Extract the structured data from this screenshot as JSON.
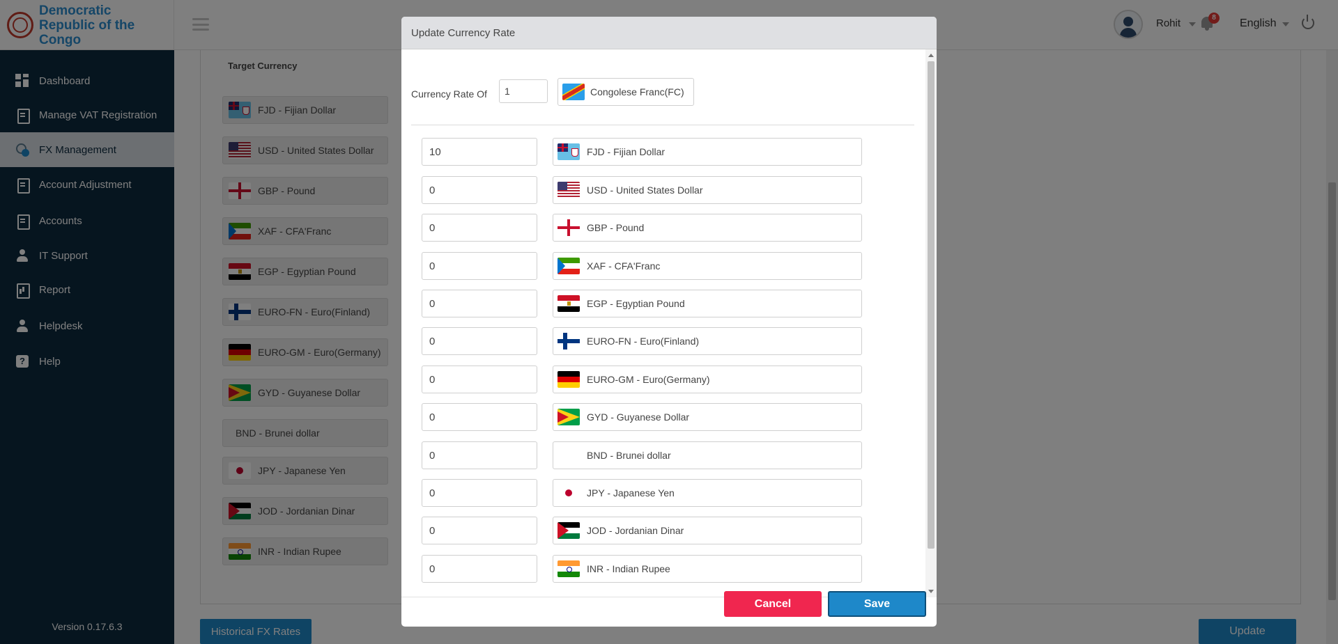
{
  "header": {
    "logo_text": "Democratic Republic of the Congo",
    "user_name": "Rohit",
    "notification_count": "8",
    "language": "English"
  },
  "sidebar": {
    "items": [
      {
        "label": "Dashboard",
        "icon": "dashboard-icon"
      },
      {
        "label": "Manage VAT Registration",
        "icon": "document-icon"
      },
      {
        "label": "FX Management",
        "icon": "fx-icon",
        "active": true
      },
      {
        "label": "Account Adjustment",
        "icon": "document-icon"
      },
      {
        "label": "Accounts",
        "icon": "document-icon"
      },
      {
        "label": "IT Support",
        "icon": "person-icon"
      },
      {
        "label": "Report",
        "icon": "report-icon"
      },
      {
        "label": "Helpdesk",
        "icon": "person-icon"
      },
      {
        "label": "Help",
        "icon": "help-icon"
      }
    ],
    "version": "Version 0.17.6.3"
  },
  "page": {
    "target_currency_title": "Target Currency",
    "currencies": [
      "FJD - Fijian Dollar",
      "USD - United States Dollar",
      "GBP - Pound",
      "XAF - CFA'Franc",
      "EGP - Egyptian Pound",
      "EURO-FN - Euro(Finland)",
      "EURO-GM - Euro(Germany)",
      "GYD - Guyanese Dollar",
      "BND - Brunei dollar",
      "JPY - Japanese Yen",
      "JOD - Jordanian Dinar",
      "INR - Indian Rupee"
    ],
    "historical_button": "Historical FX Rates",
    "update_button": "Update"
  },
  "modal": {
    "title": "Update Currency Rate",
    "rate_label": "Currency Rate Of",
    "rate_value": "1",
    "base_currency": "Congolese Franc(FC)",
    "rows": [
      {
        "value": "10",
        "currency": "FJD - Fijian Dollar",
        "flag": "fj"
      },
      {
        "value": "0",
        "currency": "USD - United States Dollar",
        "flag": "us"
      },
      {
        "value": "0",
        "currency": "GBP - Pound",
        "flag": "gb"
      },
      {
        "value": "0",
        "currency": "XAF - CFA'Franc",
        "flag": "gq"
      },
      {
        "value": "0",
        "currency": "EGP - Egyptian Pound",
        "flag": "eg"
      },
      {
        "value": "0",
        "currency": "EURO-FN - Euro(Finland)",
        "flag": "fi"
      },
      {
        "value": "0",
        "currency": "EURO-GM - Euro(Germany)",
        "flag": "de"
      },
      {
        "value": "0",
        "currency": "GYD - Guyanese Dollar",
        "flag": "gy"
      },
      {
        "value": "0",
        "currency": "BND - Brunei dollar",
        "flag": "none"
      },
      {
        "value": "0",
        "currency": "JPY - Japanese Yen",
        "flag": "jp"
      },
      {
        "value": "0",
        "currency": "JOD - Jordanian Dinar",
        "flag": "jo"
      },
      {
        "value": "0",
        "currency": "INR - Indian Rupee",
        "flag": "in"
      }
    ],
    "cancel_label": "Cancel",
    "save_label": "Save"
  },
  "colors": {
    "sidebar_bg": "#0d2a3f",
    "primary": "#1e88c9",
    "danger": "#f0264f"
  }
}
